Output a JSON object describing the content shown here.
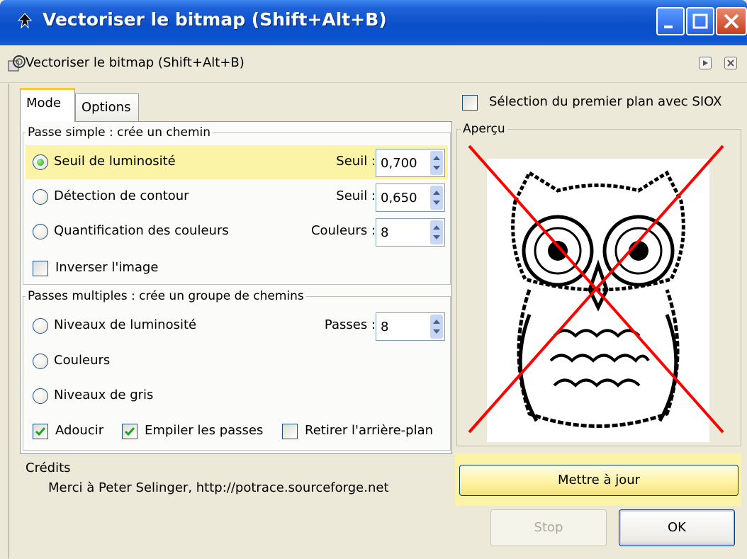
{
  "window": {
    "title": "Vectoriser le bitmap (Shift+Alt+B)",
    "dock_title": "Vectoriser le bitmap (Shift+Alt+B)"
  },
  "tabs": [
    {
      "label": "Mode",
      "active": true
    },
    {
      "label": "Options",
      "active": false
    }
  ],
  "single_scan": {
    "label": "Passe simple : crée un chemin",
    "options": [
      {
        "label": "Seuil de luminosité",
        "selected": true,
        "param_label": "Seuil :",
        "param_value": "0,700"
      },
      {
        "label": "Détection de contour",
        "selected": false,
        "param_label": "Seuil :",
        "param_value": "0,650"
      },
      {
        "label": "Quantification des couleurs",
        "selected": false,
        "param_label": "Couleurs :",
        "param_value": "8"
      }
    ],
    "invert": {
      "label": "Inverser l'image",
      "checked": false
    }
  },
  "multi_scan": {
    "label": "Passes multiples : crée un groupe de chemins",
    "options": [
      {
        "label": "Niveaux de luminosité",
        "selected": false,
        "param_label": "Passes :",
        "param_value": "8"
      },
      {
        "label": "Couleurs",
        "selected": false
      },
      {
        "label": "Niveaux de gris",
        "selected": false
      }
    ],
    "smooth": {
      "label": "Adoucir",
      "checked": true
    },
    "stack": {
      "label": "Empiler les passes",
      "checked": true
    },
    "remove_bg": {
      "label": "Retirer l'arrière-plan",
      "checked": false
    }
  },
  "siox": {
    "label": "Sélection du premier plan avec SIOX",
    "checked": false
  },
  "preview": {
    "label": "Aperçu"
  },
  "buttons": {
    "update": "Mettre à jour",
    "stop": "Stop",
    "ok": "OK"
  },
  "credits": {
    "heading": "Crédits",
    "text": "Merci à Peter Selinger, http://potrace.sourceforge.net"
  },
  "colors": {
    "highlight": "#fbf3a6",
    "title_bar": "#0a4fc8",
    "cross": "#ff0000"
  }
}
